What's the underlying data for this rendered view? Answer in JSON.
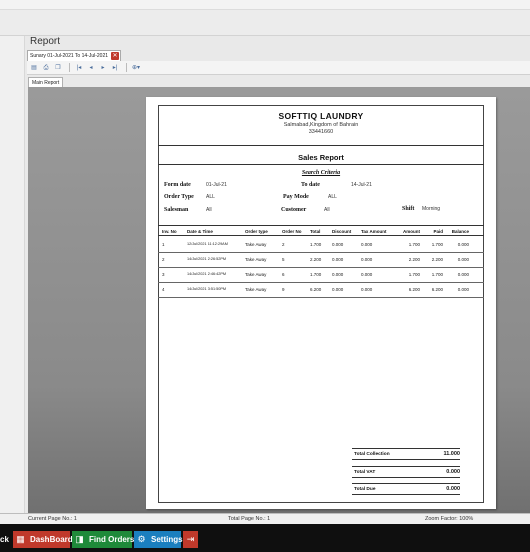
{
  "window": {
    "title": "Report",
    "tab_label": "Sunary 01-Jul-2021 To 14-Jul-2021",
    "subtab_label": "Main Report"
  },
  "toolbar": {
    "icons": [
      "export-icon",
      "print-icon",
      "copy-icon",
      "first-page-icon",
      "prev-page-icon",
      "next-page-icon",
      "last-page-icon",
      "zoom-icon"
    ]
  },
  "report": {
    "company": "SOFTTIQ LAUNDRY",
    "address": "Salmabad,Kingdom of Bahrain",
    "phone": "33441660",
    "title": "Sales Report",
    "criteria_title": "Search Criteria",
    "fields": {
      "from_date_label": "Form date",
      "from_date": "01-Jul-21",
      "to_date_label": "To date",
      "to_date": "14-Jul-21",
      "order_type_label": "Order Type",
      "order_type": "ALL",
      "pay_mode_label": "Pay Mode",
      "pay_mode": "ALL",
      "salesman_label": "Salesman",
      "salesman": "All",
      "customer_label": "Customer",
      "customer": "All",
      "shift_label": "Shift",
      "shift": "Morning"
    },
    "columns": [
      "Inv. No",
      "Date & Time",
      "Order type",
      "Order No",
      "Total",
      "Discount",
      "Tax Amount",
      "Amount",
      "Paid",
      "Balance"
    ],
    "rows": [
      [
        "1",
        "12/Jul/2021 11:12:29AM",
        "Take Away",
        "2",
        "1.700",
        "0.000",
        "0.000",
        "1.700",
        "1.700",
        "0.000"
      ],
      [
        "2",
        "14/Jul/2021 2:26:52PM",
        "Take Away",
        "5",
        "2.200",
        "0.000",
        "0.000",
        "2.200",
        "2.200",
        "0.000"
      ],
      [
        "3",
        "14/Jul/2021 2:46:42PM",
        "Take Away",
        "6",
        "1.700",
        "0.000",
        "0.000",
        "1.700",
        "1.700",
        "0.000"
      ],
      [
        "4",
        "14/Jul/2021 3:51:50PM",
        "Take Away",
        "9",
        "6.200",
        "0.000",
        "0.000",
        "6.200",
        "6.200",
        "0.000"
      ]
    ],
    "totals": {
      "collection_label": "Total Collection",
      "collection": "11.000",
      "vat_label": "Total VAT",
      "vat": "0.000",
      "due_label": "Total Due",
      "due": "0.000"
    }
  },
  "status": {
    "current_page": "Current Page No.: 1",
    "total_pages": "Total Page No.: 1",
    "zoom": "Zoom Factor: 100%"
  },
  "taskbar": {
    "back_label": "ck",
    "dashboard_label": "DashBoard",
    "find_orders_label": "Find Orders",
    "settings_label": "Settings",
    "colors": {
      "dashboard": "#c0392b",
      "find_orders": "#1f8a3a",
      "settings": "#1b7fbf",
      "exit": "#c0392b"
    }
  }
}
